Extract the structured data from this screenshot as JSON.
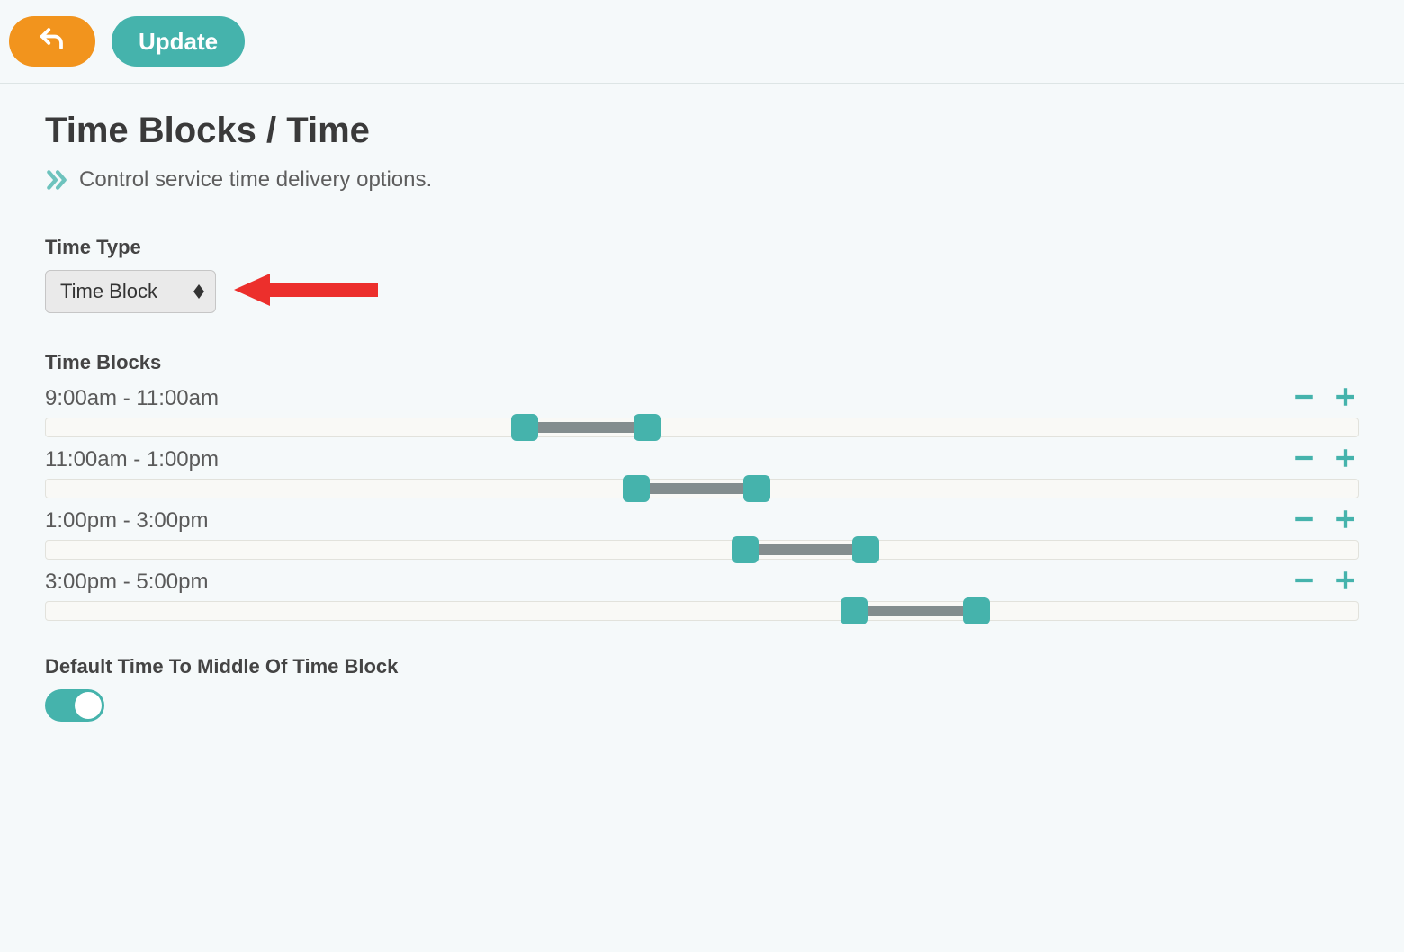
{
  "toolbar": {
    "update_label": "Update"
  },
  "page": {
    "title": "Time Blocks / Time",
    "subtitle": "Control service time delivery options."
  },
  "time_type": {
    "label": "Time Type",
    "value": "Time Block"
  },
  "time_blocks": {
    "label": "Time Blocks",
    "rows": [
      {
        "label": "9:00am - 11:00am",
        "startPct": 36.5,
        "endPct": 45.8
      },
      {
        "label": "11:00am - 1:00pm",
        "startPct": 45.0,
        "endPct": 54.2
      },
      {
        "label": "1:00pm - 3:00pm",
        "startPct": 53.3,
        "endPct": 62.5
      },
      {
        "label": "3:00pm - 5:00pm",
        "startPct": 61.6,
        "endPct": 70.9
      }
    ]
  },
  "default_middle": {
    "label": "Default Time To Middle Of Time Block",
    "value": true
  }
}
